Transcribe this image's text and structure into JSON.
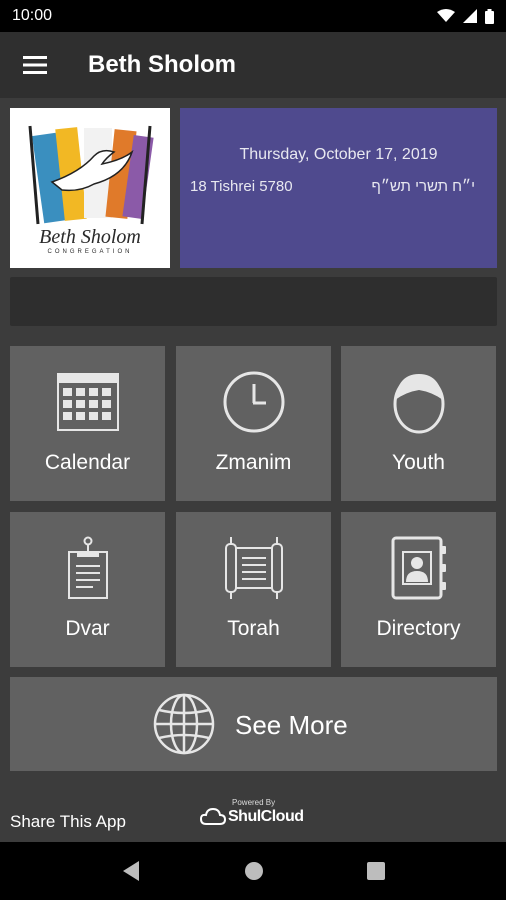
{
  "status_bar": {
    "time": "10:00"
  },
  "app_bar": {
    "title": "Beth Sholom",
    "menu_icon": "hamburger-menu-icon"
  },
  "logo": {
    "line1": "Beth Sholom",
    "line2": "CONGREGATION"
  },
  "date_panel": {
    "gregorian": "Thursday, October 17, 2019",
    "hebrew_transliterated": "18 Tishrei 5780",
    "hebrew_native": "י״ח תשרי תש״ף"
  },
  "tiles": [
    {
      "label": "Calendar",
      "icon": "calendar-icon"
    },
    {
      "label": "Zmanim",
      "icon": "clock-icon"
    },
    {
      "label": "Youth",
      "icon": "person-icon"
    },
    {
      "label": "Dvar",
      "icon": "notepad-icon"
    },
    {
      "label": "Torah",
      "icon": "torah-scroll-icon"
    },
    {
      "label": "Directory",
      "icon": "contact-book-icon"
    }
  ],
  "see_more": {
    "label": "See More",
    "icon": "globe-icon"
  },
  "footer": {
    "share_label": "Share This App",
    "powered_by": "Powered By",
    "brand": "ShulCloud"
  },
  "colors": {
    "background": "#3c3c3c",
    "app_bar": "#2f2f2f",
    "date_panel": "#4f4a8e",
    "tile": "#616161"
  }
}
